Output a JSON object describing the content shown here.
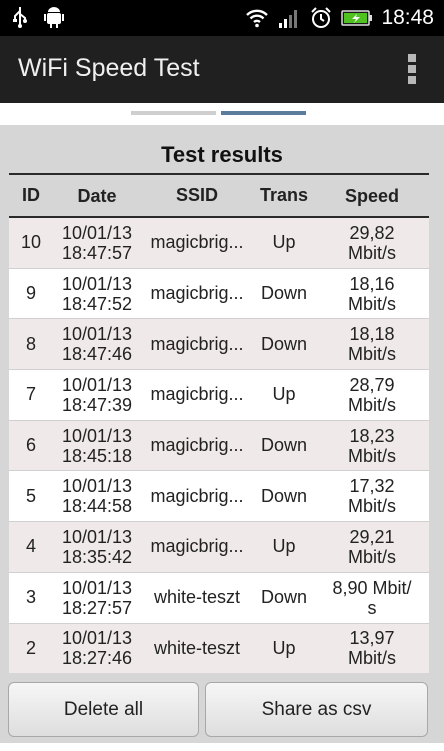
{
  "status_bar": {
    "time": "18:48",
    "left_icons": [
      "usb-icon",
      "android-debug-icon"
    ],
    "right_icons": [
      "wifi-icon",
      "signal-icon",
      "alarm-icon",
      "battery-icon"
    ],
    "battery_color": "#4fc21f"
  },
  "action_bar": {
    "title": "WiFi Speed Test",
    "overflow_icon": "overflow-menu-icon"
  },
  "pager": {
    "pages": 2,
    "active_page": 2
  },
  "results": {
    "title": "Test results",
    "columns": [
      "ID",
      "Date",
      "SSID",
      "Trans",
      "Speed"
    ],
    "rows": [
      {
        "id": "10",
        "date_line1": "10/01/13",
        "date_line2": "18:47:57",
        "ssid": "magicbrig...",
        "trans": "Up",
        "speed_line1": "29,82",
        "speed_line2": "Mbit/s"
      },
      {
        "id": "9",
        "date_line1": "10/01/13",
        "date_line2": "18:47:52",
        "ssid": "magicbrig...",
        "trans": "Down",
        "speed_line1": "18,16",
        "speed_line2": "Mbit/s"
      },
      {
        "id": "8",
        "date_line1": "10/01/13",
        "date_line2": "18:47:46",
        "ssid": "magicbrig...",
        "trans": "Down",
        "speed_line1": "18,18",
        "speed_line2": "Mbit/s"
      },
      {
        "id": "7",
        "date_line1": "10/01/13",
        "date_line2": "18:47:39",
        "ssid": "magicbrig...",
        "trans": "Up",
        "speed_line1": "28,79",
        "speed_line2": "Mbit/s"
      },
      {
        "id": "6",
        "date_line1": "10/01/13",
        "date_line2": "18:45:18",
        "ssid": "magicbrig...",
        "trans": "Down",
        "speed_line1": "18,23",
        "speed_line2": "Mbit/s"
      },
      {
        "id": "5",
        "date_line1": "10/01/13",
        "date_line2": "18:44:58",
        "ssid": "magicbrig...",
        "trans": "Down",
        "speed_line1": "17,32",
        "speed_line2": "Mbit/s"
      },
      {
        "id": "4",
        "date_line1": "10/01/13",
        "date_line2": "18:35:42",
        "ssid": "magicbrig...",
        "trans": "Up",
        "speed_line1": "29,21",
        "speed_line2": "Mbit/s"
      },
      {
        "id": "3",
        "date_line1": "10/01/13",
        "date_line2": "18:27:57",
        "ssid": "white-teszt",
        "trans": "Down",
        "speed_line1": "8,90 Mbit/",
        "speed_line2": "s"
      },
      {
        "id": "2",
        "date_line1": "10/01/13",
        "date_line2": "18:27:46",
        "ssid": "white-teszt",
        "trans": "Up",
        "speed_line1": "13,97",
        "speed_line2": "Mbit/s"
      }
    ]
  },
  "buttons": {
    "delete_all": "Delete all",
    "share_csv": "Share as csv"
  }
}
